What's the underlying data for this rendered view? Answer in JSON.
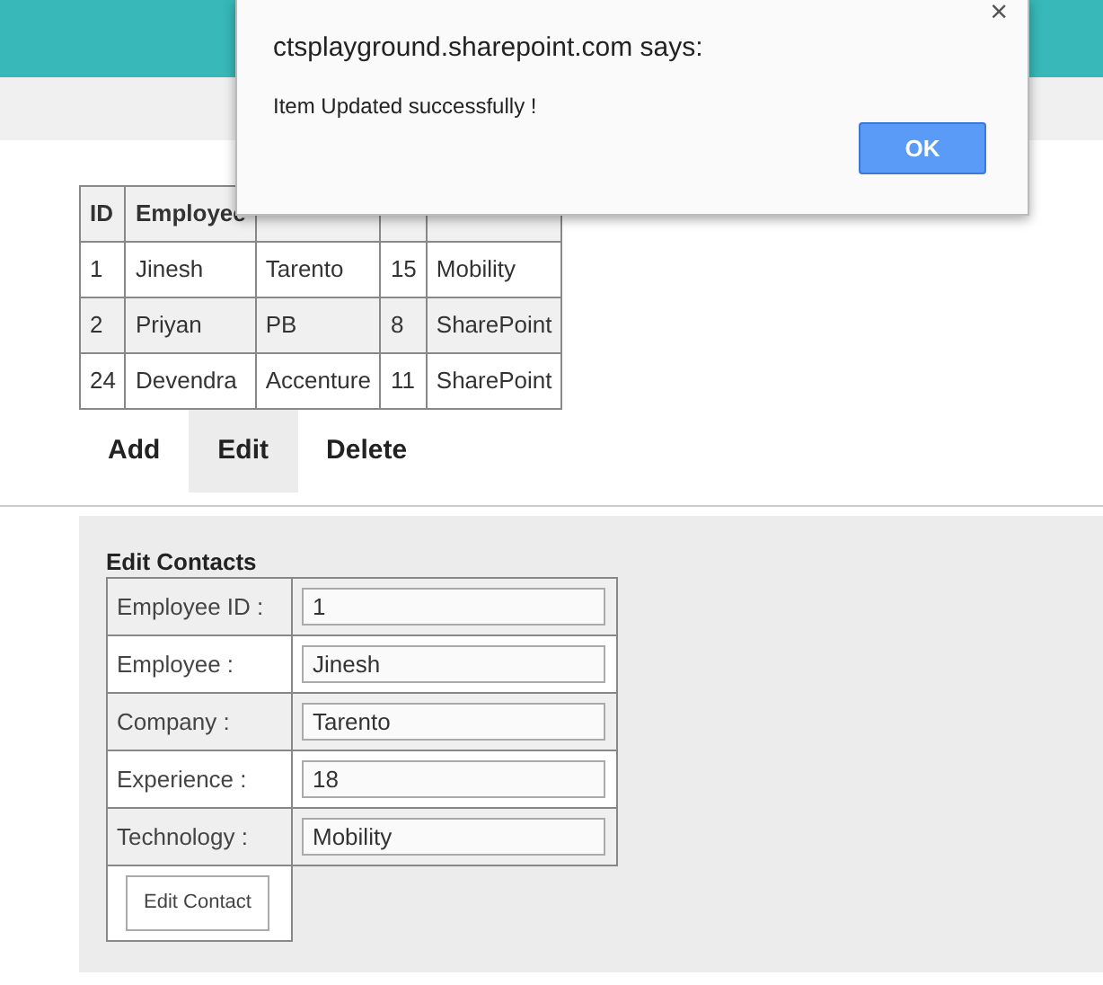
{
  "table": {
    "columns": [
      "ID",
      "Employee"
    ],
    "rows": [
      [
        "1",
        "Jinesh",
        "Tarento",
        "15",
        "Mobility"
      ],
      [
        "2",
        "Priyan",
        "PB",
        "8",
        "SharePoint"
      ],
      [
        "24",
        "Devendra",
        "Accenture",
        "11",
        "SharePoint"
      ]
    ]
  },
  "actions": [
    {
      "label": "Add",
      "selected": false
    },
    {
      "label": "Edit",
      "selected": true
    },
    {
      "label": "Delete",
      "selected": false
    }
  ],
  "edit_form": {
    "title": "Edit Contacts",
    "fields": [
      {
        "label": "Employee ID :",
        "value": "1"
      },
      {
        "label": "Employee :",
        "value": "Jinesh"
      },
      {
        "label": "Company :",
        "value": "Tarento"
      },
      {
        "label": "Experience :",
        "value": "18"
      },
      {
        "label": "Technology :",
        "value": "Mobility"
      }
    ],
    "button": "Edit Contact"
  },
  "dialog": {
    "title": "ctsplayground.sharepoint.com says:",
    "message": "Item Updated successfully !",
    "close": "×",
    "button": "OK"
  }
}
